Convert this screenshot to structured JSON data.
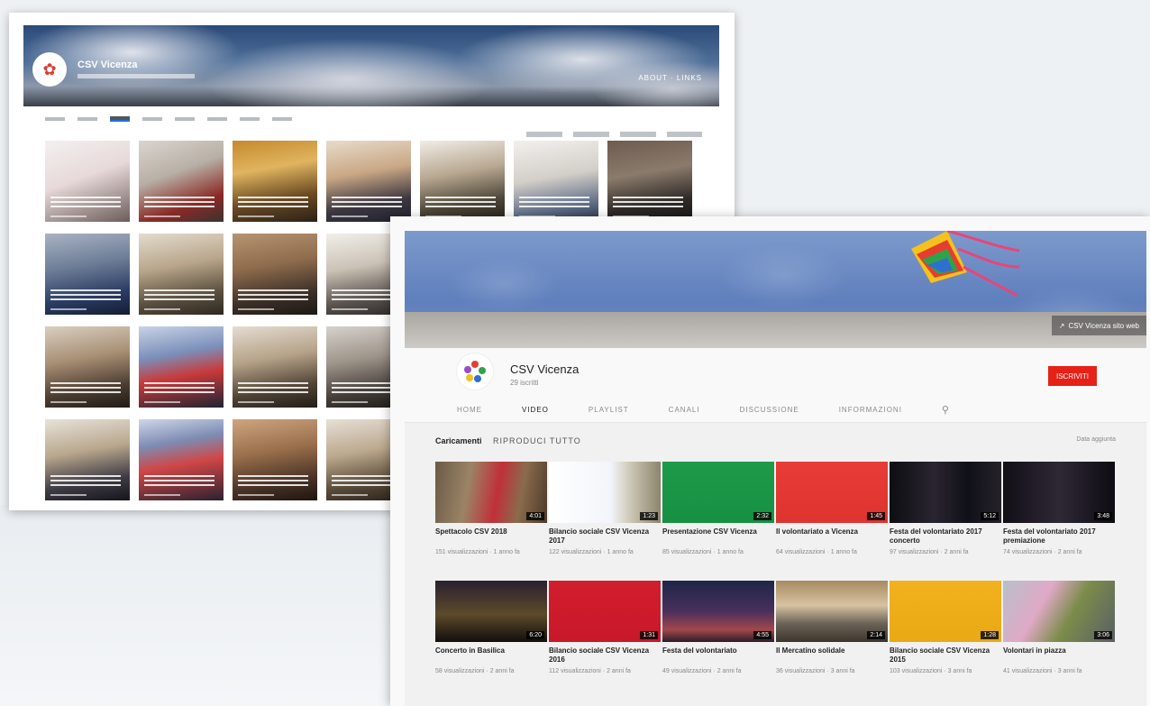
{
  "back_window": {
    "channel_name": "CSV Vicenza",
    "banner_links": "ABOUT · LINKS",
    "photos": [
      {
        "bg": "linear-gradient(160deg,#f4f0f0 0%,#e7d9d9 45%,#6b5c5a 100%)"
      },
      {
        "bg": "linear-gradient(160deg,#d9d5cf 0%,#b8b0a6 40%,#8a2a26 75%,#3a3330 100%)"
      },
      {
        "bg": "linear-gradient(170deg,#c58a2c 0%,#e0b460 35%,#6a4a22 70%,#2a2118 100%)"
      },
      {
        "bg": "linear-gradient(170deg,#e8dccc 0%,#c9a785 40%,#3c3740 75%,#1f2230 100%)"
      },
      {
        "bg": "linear-gradient(170deg,#f0ede6 0%,#b9a892 40%,#4c4638 75%,#262219 100%)"
      },
      {
        "bg": "linear-gradient(170deg,#f2f0ee 0%,#d3cec8 45%,#5d6c86 80%,#2c3446 100%)"
      },
      {
        "bg": "linear-gradient(170deg,#6c5b4f 0%,#8b7b6c 40%,#2f2a28 75%,#181616 100%)"
      },
      {
        "bg": "linear-gradient(170deg,#a9b3c3 0%,#6d7d97 40%,#2a3b63 75%,#141c33 100%)"
      },
      {
        "bg": "linear-gradient(170deg,#e3dcce 0%,#b9a58b 40%,#5b503f 75%,#2d2820 100%)"
      },
      {
        "bg": "linear-gradient(170deg,#b79471 0%,#8d6b4c 40%,#3d3028 75%,#1c1814 100%)"
      },
      {
        "bg": "linear-gradient(170deg,#f1efea 0%,#cbc2b6 40%,#5c5550 75%,#2a2726 100%)"
      },
      {
        "bg": "linear-gradient(170deg,#e9e6e1 0%,#b3a9a0 40%,#524c46 75%,#25211e 100%)"
      },
      {
        "bg": "linear-gradient(170deg,#efece8 0%,#c7bfb4 40%,#585148 75%,#26221e 100%)"
      },
      {
        "bg": "linear-gradient(170deg,#e7e1d7 0%,#bfae97 40%,#5a4b3a 75%,#28221b 100%)"
      },
      {
        "bg": "linear-gradient(170deg,#d9cfc2 0%,#a88f74 40%,#4c3d31 75%,#201a15 100%)"
      },
      {
        "bg": "linear-gradient(170deg,#c9d3e6 0%,#7b8fba 35%,#c83a3a 60%,#1e2433 100%)"
      },
      {
        "bg": "linear-gradient(170deg,#e4ddd2 0%,#b6a288 40%,#4f4335 75%,#221d17 100%)"
      },
      {
        "bg": "linear-gradient(170deg,#d6d2cd 0%,#9e948a 40%,#453f3a 75%,#1d1a18 100%)"
      },
      {
        "bg": "linear-gradient(170deg,#f1ede5 0%,#c9b8a0 40%,#544635 75%,#231d16 100%)"
      },
      {
        "bg": "linear-gradient(170deg,#e6e2dc 0%,#b5aa9d 40%,#4e473f 75%,#221f1b 100%)"
      },
      {
        "bg": "linear-gradient(170deg,#e0d8cc 0%,#a99680 40%,#4a3e31 75%,#201b15 100%)"
      },
      {
        "bg": "linear-gradient(170deg,#e7e3da 0%,#b9a78d 40%,#3d3a44 75%,#16151b 100%)"
      },
      {
        "bg": "linear-gradient(170deg,#cfd6e8 0%,#7d8cb3 30%,#d04646 55%,#2a2230 100%)"
      },
      {
        "bg": "linear-gradient(170deg,#cfa580 0%,#9a6f4c 40%,#4a3326 75%,#1e1510 100%)"
      },
      {
        "bg": "linear-gradient(170deg,#e6e0d6 0%,#bca88e 40%,#594a38 75%,#27211a 100%)"
      },
      {
        "bg": "linear-gradient(170deg,#dcd6cd 0%,#aa9c8b 40%,#4b4339 75%,#201d19 100%)"
      },
      {
        "bg": "linear-gradient(170deg,#e9e4dc 0%,#bdae98 40%,#57493a 75%,#251f19 100%)"
      },
      {
        "bg": "linear-gradient(170deg,#e2dcd2 0%,#b3a18a 40%,#514435 75%,#231d17 100%)"
      }
    ]
  },
  "front_window": {
    "channel_name": "CSV Vicenza",
    "subscribers": "29 iscritti",
    "subscribe_label": "ISCRIVITI",
    "banner_link": "CSV Vicenza sito web",
    "tabs": [
      "HOME",
      "VIDEO",
      "PLAYLIST",
      "CANALI",
      "DISCUSSIONE",
      "INFORMAZIONI"
    ],
    "section_title": "Caricamenti",
    "section_play": "RIPRODUCI TUTTO",
    "section_right": "Data aggiunta",
    "videos": [
      {
        "title": "Spettacolo CSV 2018",
        "meta": "151 visualizzazioni · 1 anno fa",
        "duration": "4:01",
        "bg": "linear-gradient(100deg,#6a5a47 0%,#9b8466 30%,#c03038 55%,#8a6b4c 75%,#4c3a2a 100%)"
      },
      {
        "title": "Bilancio sociale CSV Vicenza 2017",
        "meta": "122 visualizzazioni · 1 anno fa",
        "duration": "1:23",
        "bg": "linear-gradient(90deg,#ffffff 0%,#f2f5fa 55%,#c9c2b0 75%,#8c846d 100%)"
      },
      {
        "title": "Presentazione CSV Vicenza",
        "meta": "85 visualizzazioni · 1 anno fa",
        "duration": "2:32",
        "bg": "linear-gradient(180deg,#1e9a4a 0%,#179043 100%)"
      },
      {
        "title": "Il volontariato a Vicenza",
        "meta": "64 visualizzazioni · 1 anno fa",
        "duration": "1:45",
        "bg": "linear-gradient(180deg,#e73c37 0%,#de3430 100%)"
      },
      {
        "title": "Festa del volontariato 2017 concerto",
        "meta": "97 visualizzazioni · 2 anni fa",
        "duration": "5:12",
        "bg": "linear-gradient(90deg,#0d0d12 0%,#2a2530 40%,#101018 70%,#26222a 100%)"
      },
      {
        "title": "Festa del volontariato 2017 premiazione",
        "meta": "74 visualizzazioni · 2 anni fa",
        "duration": "3:48",
        "bg": "linear-gradient(90deg,#120f16 0%,#2e2836 50%,#0e0c12 100%)"
      },
      {
        "title": "Concerto in Basilica",
        "meta": "58 visualizzazioni · 2 anni fa",
        "duration": "6:20",
        "bg": "linear-gradient(180deg,#2a2030 0%,#5c4a2a 55%,#120e0c 100%)"
      },
      {
        "title": "Bilancio sociale CSV Vicenza 2016",
        "meta": "112 visualizzazioni · 2 anni fa",
        "duration": "1:31",
        "bg": "linear-gradient(180deg,#d21e2e 0%,#c8182a 100%)"
      },
      {
        "title": "Festa del volontariato",
        "meta": "49 visualizzazioni · 2 anni fa",
        "duration": "4:55",
        "bg": "linear-gradient(180deg,#1d2648 0%,#4a2f5c 50%,#a2474c 80%,#2b1d2a 100%)"
      },
      {
        "title": "Il Mercatino solidale",
        "meta": "36 visualizzazioni · 3 anni fa",
        "duration": "2:14",
        "bg": "linear-gradient(180deg,#a68a63 0%,#d8c2a2 40%,#6b6358 70%,#3b352c 100%)"
      },
      {
        "title": "Bilancio sociale CSV Vicenza 2015",
        "meta": "103 visualizzazioni · 3 anni fa",
        "duration": "1:28",
        "bg": "linear-gradient(180deg,#f1b21e 0%,#e9a914 100%)"
      },
      {
        "title": "Volontari in piazza",
        "meta": "41 visualizzazioni · 3 anni fa",
        "duration": "3:06",
        "bg": "linear-gradient(120deg,#b8c0c8 0%,#e0a9c7 35%,#7c8c4a 60%,#5a5e66 100%)"
      }
    ]
  }
}
